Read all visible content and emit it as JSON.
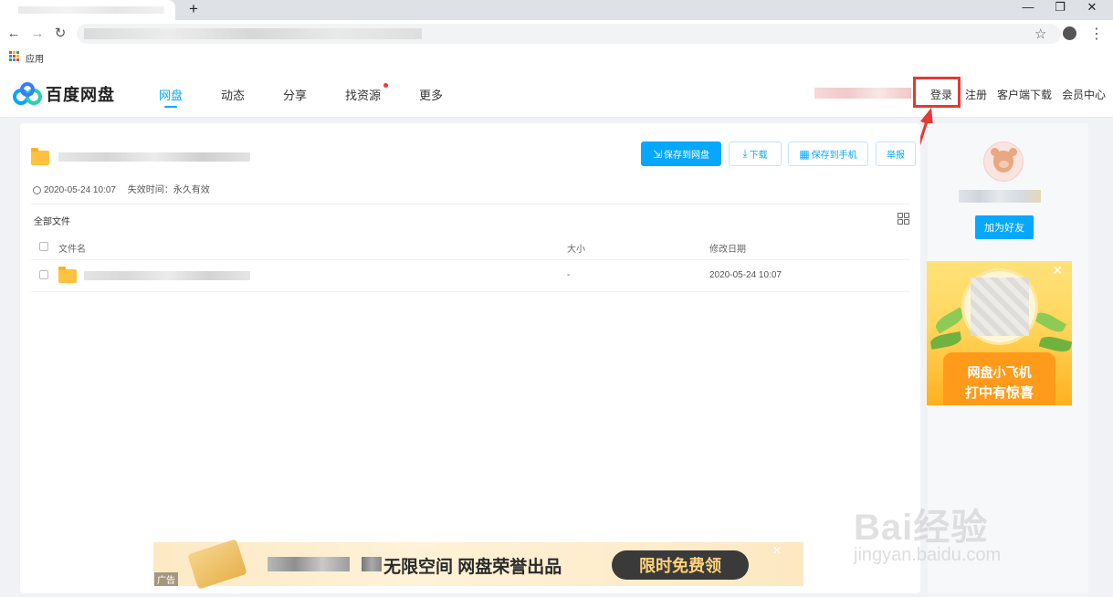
{
  "browser": {
    "new_tab": "+",
    "window_controls": [
      "—",
      "❐",
      "✕"
    ],
    "nav": [
      "←",
      "→",
      "↻"
    ],
    "star": "☆",
    "menu": "⋮",
    "apps_label": "应用"
  },
  "header": {
    "logo_text": "百度网盘",
    "nav": [
      "网盘",
      "动态",
      "分享",
      "找资源",
      "更多"
    ],
    "active_nav": "网盘",
    "login": "登录",
    "register": "注册",
    "client_download": "客户端下载",
    "vip_center": "会员中心",
    "brand_color": "#06a7ff"
  },
  "share": {
    "date": "2020-05-24 10:07",
    "expiry": "失效时间：永久有效",
    "buttons": {
      "save_to_disk": "保存到网盘",
      "download": "下载",
      "save_to_phone": "保存到手机",
      "report": "举报"
    },
    "breadcrumb": "全部文件",
    "columns": [
      "文件名",
      "大小",
      "修改日期"
    ],
    "rows": [
      {
        "size": "-",
        "modified": "2020-05-24 10:07"
      }
    ]
  },
  "sidebar": {
    "add_friend": "加为好友",
    "ad_line1": "网盘小飞机",
    "ad_line2": "打中有惊喜",
    "ad_close": "✕"
  },
  "banner": {
    "text": "无限空间 网盘荣誉出品",
    "cta": "限时免费领",
    "ad_tag": "广告",
    "close": "✕"
  },
  "watermark": {
    "line1": "Bai经验",
    "line2": "jingyan.baidu.com"
  }
}
